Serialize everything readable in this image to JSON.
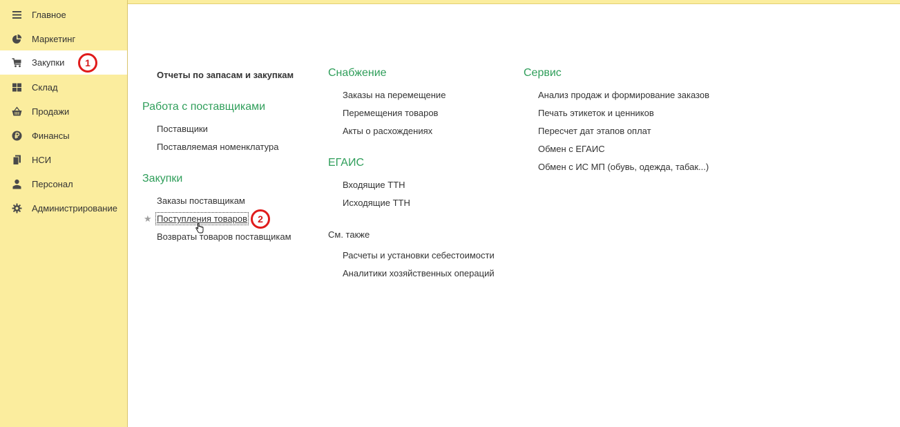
{
  "sidebar": {
    "items": [
      {
        "label": "Главное",
        "icon": "menu-lines-icon"
      },
      {
        "label": "Маркетинг",
        "icon": "pie-chart-icon"
      },
      {
        "label": "Закупки",
        "icon": "shopping-cart-icon"
      },
      {
        "label": "Склад",
        "icon": "warehouse-grid-icon"
      },
      {
        "label": "Продажи",
        "icon": "basket-icon"
      },
      {
        "label": "Финансы",
        "icon": "ruble-coin-icon"
      },
      {
        "label": "НСИ",
        "icon": "documents-icon"
      },
      {
        "label": "Персонал",
        "icon": "person-icon"
      },
      {
        "label": "Администрирование",
        "icon": "gear-icon"
      }
    ],
    "active_index": 2
  },
  "callouts": {
    "first": "1",
    "second": "2"
  },
  "columns": {
    "left": {
      "top_link": "Отчеты по запасам и закупкам",
      "sections": [
        {
          "title": "Работа с поставщиками",
          "links": [
            "Поставщики",
            "Поставляемая номенклатура"
          ]
        },
        {
          "title": "Закупки",
          "links": [
            "Заказы поставщикам",
            "Поступления товаров",
            "Возвраты товаров поставщикам"
          ]
        }
      ]
    },
    "middle": {
      "sections": [
        {
          "title": "Снабжение",
          "links": [
            "Заказы на перемещение",
            "Перемещения товаров",
            "Акты о расхождениях"
          ]
        },
        {
          "title": "ЕГАИС",
          "links": [
            "Входящие ТТН",
            "Исходящие ТТН"
          ]
        }
      ],
      "see_also": {
        "title": "См. также",
        "links": [
          "Расчеты и установки себестоимости",
          "Аналитики хозяйственных операций"
        ]
      }
    },
    "right": {
      "sections": [
        {
          "title": "Сервис",
          "links": [
            "Анализ продаж и формирование заказов",
            "Печать этикеток и ценников",
            "Пересчет дат этапов оплат",
            "Обмен с ЕГАИС",
            "Обмен с ИС МП (обувь, одежда, табак...)"
          ]
        }
      ]
    }
  },
  "colors": {
    "sidebar_bg": "#fbed9e",
    "section_title": "#2f9e5a",
    "callout": "#e01b1b"
  }
}
